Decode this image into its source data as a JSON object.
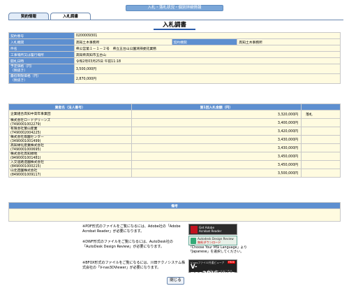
{
  "header": {
    "banner": "入札・落札状況・個別詳細情報"
  },
  "tabs": [
    {
      "label": "契約情報"
    },
    {
      "label": "入札調書"
    }
  ],
  "page_title": "入札調書",
  "info": {
    "contract_no": {
      "label": "契約番号",
      "value": "0200009301"
    },
    "ordering_org": {
      "label": "入札機関",
      "value": "高知土木事務所"
    },
    "contract_org": {
      "label": "契約機関",
      "value": "高知土木事務所"
    },
    "case_name": {
      "label": "件名",
      "value": "県公営第１－１－２号　県立五台山公園清掃委託業務"
    },
    "location": {
      "label": "工事場所又は履行場所",
      "value": "高知県高知市五台山"
    },
    "bid_date": {
      "label": "開札日時",
      "value": "令和2年03月25日 午前11:18"
    },
    "planned_price": {
      "label": "予定価格（円）\n（税抜き）",
      "value": "3,500,000円"
    },
    "min_price": {
      "label": "最低制限価格（円）\n（税抜き）",
      "value": "2,870,000円"
    }
  },
  "bids": {
    "headers": [
      "業者名（法人番号）",
      "第1回入札金額（円）",
      ""
    ],
    "rows": [
      {
        "name": "企業組合高知中高年事業団",
        "amount": "3,320,000円",
        "result": "落札"
      },
      {
        "name": "株式会社ロードグリーンズ\n(7490001002279)",
        "amount": "3,400,000円",
        "result": ""
      },
      {
        "name": "有限会社葉山産業\n(7490002004225)",
        "amount": "3,420,000円",
        "result": ""
      },
      {
        "name": "株式会社扇園センター\n(3490001001499)",
        "amount": "3,430,000円",
        "result": ""
      },
      {
        "name": "高知緑化産業株式会社\n(7490001000695)",
        "amount": "3,430,000円",
        "result": ""
      },
      {
        "name": "株式会社高知緑地\n(9490001001481)",
        "amount": "3,450,000円",
        "result": ""
      },
      {
        "name": "入交道路造園株式会社\n(8490001000215)",
        "amount": "3,450,000円",
        "result": ""
      },
      {
        "name": "山北造園株式会社\n(8490001009117)",
        "amount": "3,500,000円",
        "result": ""
      }
    ]
  },
  "notes": {
    "header": "備考",
    "value": ""
  },
  "plugins": {
    "pdf_text": "※PDF形式のファイルをご覧になるには、Adobe社の「Adobe Acrobat Reader」が必要になります。",
    "dwf_text": "※DWF形式のファイルをご覧になるには、AutoDesk社の「AutoDesk Design Review」が必要になります。",
    "bfox_text": "※BFOX形式のファイルをご覧になるには、川田テクノシステム株式会社の「V-nas3DViewer」が必要になります。",
    "adobe_banner": "Get Adobe\nAcrobat Reader",
    "autodesk_banner_1": "Autodesk Design Review",
    "autodesk_banner_2": "無料ダウンロード",
    "autodesk_note": "「Choose Your MSI Language」より「Japanese」を選択してください。",
    "vnas_top": "V-nasファイル共通ビューア",
    "vnas_main": "V-nas3DViewer",
    "vnas_free": "FREE",
    "vnas_sub": "ダウンロードはこちら"
  },
  "close_button": "閉じる"
}
